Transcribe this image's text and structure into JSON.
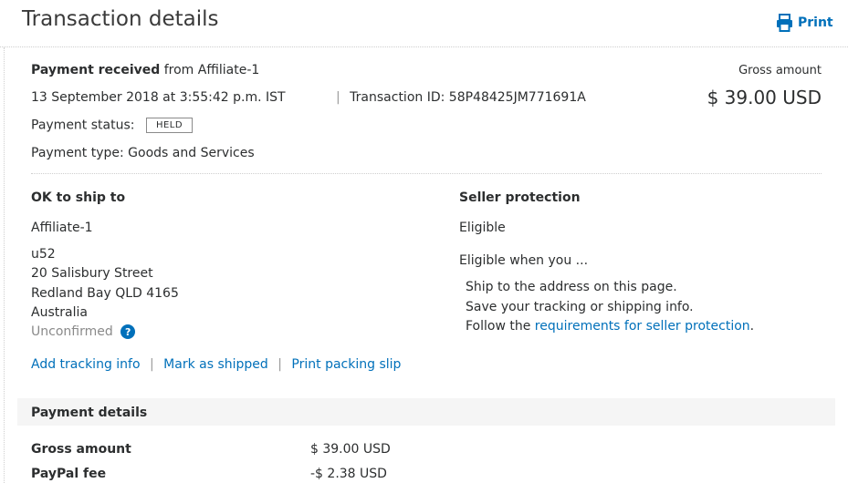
{
  "header": {
    "title": "Transaction details",
    "print_label": "Print"
  },
  "summary": {
    "received_label": "Payment received",
    "from_text": "from Affiliate-1",
    "datetime": "13 September 2018 at 3:55:42 p.m. IST",
    "txn_label": "Transaction ID: 58P48425JM771691A",
    "status_label": "Payment status:",
    "status_value": "HELD",
    "payment_type": "Payment type: Goods and Services",
    "gross_label": "Gross amount",
    "gross_amount": "$ 39.00 USD"
  },
  "shipping": {
    "heading": "OK to ship to",
    "name": "Affiliate-1",
    "address": [
      "u52",
      "20 Salisbury Street",
      "Redland Bay QLD 4165",
      "Australia"
    ],
    "status": "Unconfirmed",
    "help_glyph": "?",
    "links": [
      "Add tracking info",
      "Mark as shipped",
      "Print packing slip"
    ]
  },
  "protection": {
    "heading": "Seller protection",
    "status": "Eligible",
    "when": "Eligible when you ...",
    "items": [
      "Ship to the address on this page.",
      "Save your tracking or shipping info."
    ],
    "follow_prefix": "Follow the ",
    "follow_link": "requirements for seller protection",
    "follow_suffix": "."
  },
  "payment_details": {
    "title": "Payment details",
    "rows": [
      {
        "label": "Gross amount",
        "value": "$ 39.00 USD"
      },
      {
        "label": "PayPal fee",
        "value": "-$ 2.38 USD"
      }
    ]
  },
  "colors": {
    "link": "#0070ba",
    "text": "#2c2e2f",
    "muted": "#8a8a8a",
    "section_bg": "#f5f5f5"
  },
  "icons": {
    "print": "printer-icon",
    "help": "help-icon"
  }
}
